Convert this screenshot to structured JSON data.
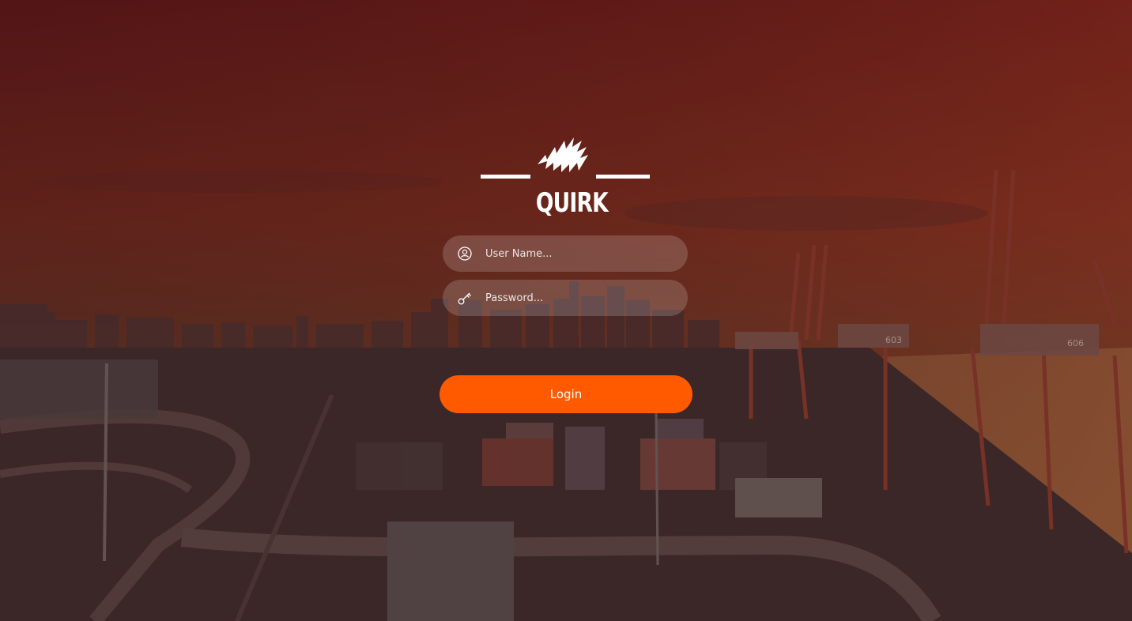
{
  "brand": {
    "name": "QUIRK",
    "logo_icon": "lightning-waves-logo-icon"
  },
  "login_form": {
    "username": {
      "placeholder": "User Name...",
      "value": "",
      "icon": "user-icon"
    },
    "password": {
      "placeholder": "Password...",
      "value": "",
      "icon": "key-icon"
    },
    "submit_label": "Login"
  },
  "background": {
    "subject": "port-container-terminal-city-skyline",
    "crane_labels": [
      "603",
      "606"
    ]
  },
  "colors": {
    "accent": "#ff5a00",
    "overlay_top": "#6e1a1e",
    "overlay_bottom": "#3a2222",
    "text": "#ffffff"
  }
}
